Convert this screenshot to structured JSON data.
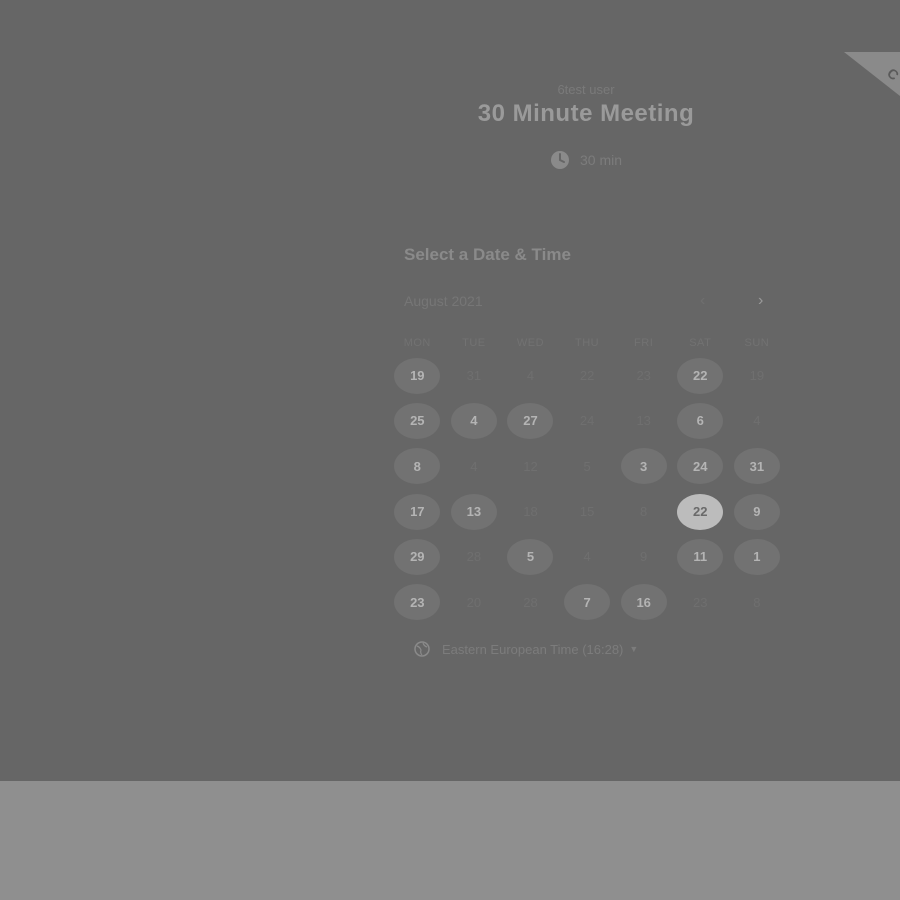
{
  "event": {
    "owner": "6test user",
    "title": "30 Minute Meeting",
    "duration": "30 min"
  },
  "corner_badge": {
    "label": "C"
  },
  "calendar": {
    "section_title": "Select a Date & Time",
    "month": "August 2021",
    "weekdays": [
      "MON",
      "TUE",
      "WED",
      "THU",
      "FRI",
      "SAT",
      "SUN"
    ],
    "weeks": [
      [
        {
          "d": "19",
          "s": "avail"
        },
        {
          "d": "31",
          "s": "unavail"
        },
        {
          "d": "4",
          "s": "unavail"
        },
        {
          "d": "22",
          "s": "unavail"
        },
        {
          "d": "23",
          "s": "unavail"
        },
        {
          "d": "22",
          "s": "avail"
        },
        {
          "d": "19",
          "s": "unavail"
        }
      ],
      [
        {
          "d": "25",
          "s": "avail"
        },
        {
          "d": "4",
          "s": "avail"
        },
        {
          "d": "27",
          "s": "avail"
        },
        {
          "d": "24",
          "s": "unavail"
        },
        {
          "d": "13",
          "s": "unavail"
        },
        {
          "d": "6",
          "s": "avail"
        },
        {
          "d": "4",
          "s": "unavail"
        }
      ],
      [
        {
          "d": "8",
          "s": "avail"
        },
        {
          "d": "4",
          "s": "unavail"
        },
        {
          "d": "12",
          "s": "unavail"
        },
        {
          "d": "5",
          "s": "unavail"
        },
        {
          "d": "3",
          "s": "avail"
        },
        {
          "d": "24",
          "s": "avail"
        },
        {
          "d": "31",
          "s": "avail"
        }
      ],
      [
        {
          "d": "17",
          "s": "avail"
        },
        {
          "d": "13",
          "s": "avail"
        },
        {
          "d": "18",
          "s": "unavail"
        },
        {
          "d": "15",
          "s": "unavail"
        },
        {
          "d": "8",
          "s": "unavail"
        },
        {
          "d": "22",
          "s": "selected"
        },
        {
          "d": "9",
          "s": "avail"
        }
      ],
      [
        {
          "d": "29",
          "s": "avail"
        },
        {
          "d": "28",
          "s": "unavail"
        },
        {
          "d": "5",
          "s": "avail"
        },
        {
          "d": "4",
          "s": "unavail"
        },
        {
          "d": "9",
          "s": "unavail"
        },
        {
          "d": "11",
          "s": "avail"
        },
        {
          "d": "1",
          "s": "avail"
        }
      ],
      [
        {
          "d": "23",
          "s": "avail"
        },
        {
          "d": "20",
          "s": "unavail"
        },
        {
          "d": "28",
          "s": "unavail"
        },
        {
          "d": "7",
          "s": "avail"
        },
        {
          "d": "16",
          "s": "avail"
        },
        {
          "d": "23",
          "s": "unavail"
        },
        {
          "d": "8",
          "s": "unavail"
        }
      ]
    ],
    "prev_icon": "chevron-left-icon",
    "next_icon": "chevron-right-icon"
  },
  "timezone": {
    "label": "Eastern European Time (16:28)",
    "icon": "globe-icon"
  },
  "colors": {
    "overlay": "#666666",
    "backdrop": "#8f8f8f",
    "selected_day": "#bcbcbc"
  }
}
